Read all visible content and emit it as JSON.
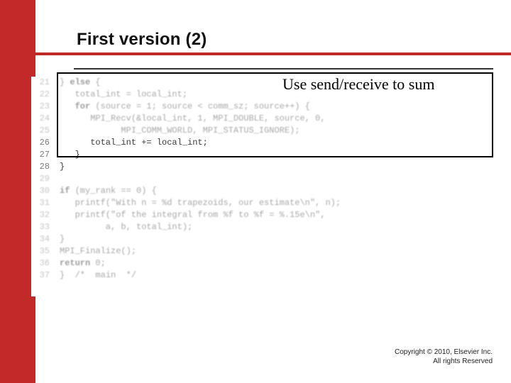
{
  "title": "First version (2)",
  "callout": {
    "label": "Use send/receive to sum"
  },
  "line_start": 21,
  "line_count": 17,
  "blurred_lines": [
    21,
    22,
    23,
    24,
    25,
    29,
    30,
    31,
    32,
    33,
    34,
    35,
    36,
    37
  ],
  "code": {
    "21": "} else {",
    "22": "   total_int = local_int;",
    "23": "   for (source = 1; source < comm_sz; source++) {",
    "24": "      MPI_Recv(&local_int, 1, MPI_DOUBLE, source, 0,",
    "25": "            MPI_COMM_WORLD, MPI_STATUS_IGNORE);",
    "26": "      total_int += local_int;",
    "27": "   }",
    "28": "}",
    "29": "",
    "30": "if (my_rank == 0) {",
    "31": "   printf(\"With n = %d trapezoids, our estimate\\n\", n);",
    "32": "   printf(\"of the integral from %f to %f = %.15e\\n\",",
    "33": "         a, b, total_int);",
    "34": "}",
    "35": "MPI_Finalize();",
    "36": "return 0;",
    "37": {
      "pre": "}  ",
      "comment": "/*  main  */"
    }
  },
  "bold_tokens": {
    "21": [
      "else"
    ],
    "23": [
      "for"
    ],
    "30": [
      "if"
    ],
    "36": [
      "return"
    ]
  },
  "copyright": {
    "line1": "Copyright © 2010, Elsevier Inc.",
    "line2": "All rights Reserved"
  }
}
